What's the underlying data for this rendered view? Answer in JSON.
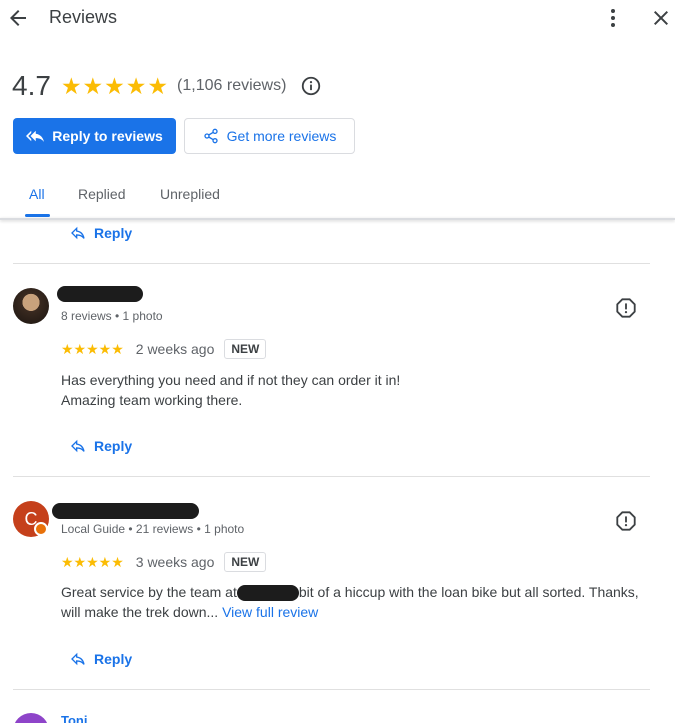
{
  "header": {
    "title": "Reviews"
  },
  "summary": {
    "rating": "4.7",
    "stars": "★★★★★",
    "review_count": "(1,106 reviews)"
  },
  "actions": {
    "reply_label": "Reply to reviews",
    "get_more_label": "Get more reviews"
  },
  "tabs": [
    {
      "label": "All",
      "active": true
    },
    {
      "label": "Replied",
      "active": false
    },
    {
      "label": "Unreplied",
      "active": false
    }
  ],
  "reply_label": "Reply",
  "reviews": [
    {
      "meta": "8 reviews • 1 photo",
      "stars": "★★★★★",
      "time": "2 weeks ago",
      "badge": "NEW",
      "text_line1": "Has everything you need and if not they can order it in!",
      "text_line2": "Amazing team working there."
    },
    {
      "avatar_letter": "C",
      "meta": "Local Guide • 21 reviews • 1 photo",
      "stars": "★★★★★",
      "time": "3 weeks ago",
      "badge": "NEW",
      "text_a": "Great service by the team at",
      "text_b": "bit of a hiccup with the loan bike but all sorted. Thanks,",
      "text_line2": "will make the trek down...",
      "view_full": "View full review"
    }
  ],
  "next_reviewer_partial": "Toni",
  "colors": {
    "accent": "#1a73e8",
    "star": "#fbbc04"
  }
}
